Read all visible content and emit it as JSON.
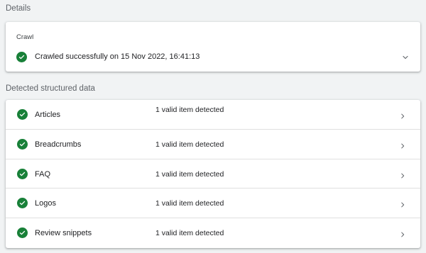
{
  "details": {
    "section_label": "Details",
    "crawl": {
      "title": "Crawl",
      "status_text": "Crawled successfully on 15 Nov 2022, 16:41:13",
      "status_icon": "check-circle-icon",
      "expand_icon": "chevron-down-icon"
    }
  },
  "structured_data": {
    "section_label": "Detected structured data",
    "items": [
      {
        "name": "Articles",
        "status": "1 valid item detected"
      },
      {
        "name": "Breadcrumbs",
        "status": "1 valid item detected"
      },
      {
        "name": "FAQ",
        "status": "1 valid item detected"
      },
      {
        "name": "Logos",
        "status": "1 valid item detected"
      },
      {
        "name": "Review snippets",
        "status": "1 valid item detected"
      }
    ]
  },
  "colors": {
    "valid_green": "#188038",
    "page_background": "#f1f3f4",
    "card_background": "#ffffff"
  }
}
